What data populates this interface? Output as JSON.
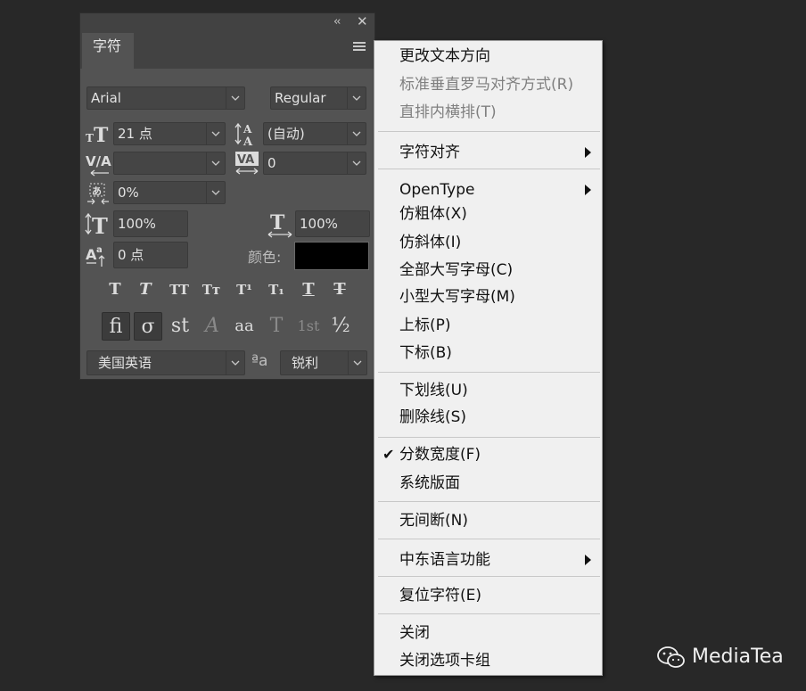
{
  "panel": {
    "tab_label": "字符",
    "collapse_glyph": "‹‹",
    "close_glyph": "✕",
    "font_family": "Arial",
    "font_style": "Regular",
    "font_size": "21 点",
    "leading": "(自动)",
    "kerning": "",
    "tracking": "0",
    "tsume": "0%",
    "vertical_scale": "100%",
    "horizontal_scale": "100%",
    "baseline_shift": "0 点",
    "color_label": "颜色:",
    "color_value": "#000000",
    "style_buttons": [
      {
        "name": "faux-bold",
        "glyph": "T"
      },
      {
        "name": "faux-italic",
        "glyph": "T"
      },
      {
        "name": "all-caps",
        "glyph": "TT"
      },
      {
        "name": "small-caps",
        "glyph": "Tт"
      },
      {
        "name": "superscript",
        "glyph": "T¹"
      },
      {
        "name": "subscript",
        "glyph": "T₁"
      },
      {
        "name": "underline",
        "glyph": "T"
      },
      {
        "name": "strikethrough",
        "glyph": "T"
      }
    ],
    "opentype_buttons": [
      {
        "name": "standard-ligatures",
        "glyph": "fi"
      },
      {
        "name": "contextual-alternates",
        "glyph": "σ"
      },
      {
        "name": "discretionary-ligatures",
        "glyph": "st"
      },
      {
        "name": "swash",
        "glyph": "A"
      },
      {
        "name": "stylistic-alternates",
        "glyph": "aa"
      },
      {
        "name": "titling-alternates",
        "glyph": "T"
      },
      {
        "name": "ordinals",
        "glyph": "1st"
      },
      {
        "name": "fractions",
        "glyph": "½"
      }
    ],
    "language": "美国英语",
    "aa_icon_glyph": "ªa",
    "antialias": "锐利"
  },
  "menu": {
    "items": [
      {
        "label": "更改文本方向",
        "disabled": false
      },
      {
        "label": "标准垂直罗马对齐方式(R)",
        "disabled": true
      },
      {
        "label": "直排内横排(T)",
        "disabled": true
      },
      {
        "label": "字符对齐",
        "submenu": true
      },
      {
        "label": "OpenType",
        "submenu": true
      },
      {
        "label": "仿粗体(X)"
      },
      {
        "label": "仿斜体(I)"
      },
      {
        "label": "全部大写字母(C)"
      },
      {
        "label": "小型大写字母(M)"
      },
      {
        "label": "上标(P)"
      },
      {
        "label": "下标(B)"
      },
      {
        "label": "下划线(U)"
      },
      {
        "label": "删除线(S)"
      },
      {
        "label": "分数宽度(F)",
        "checked": true
      },
      {
        "label": "系统版面"
      },
      {
        "label": "无间断(N)"
      },
      {
        "label": "中东语言功能",
        "submenu": true
      },
      {
        "label": "复位字符(E)"
      },
      {
        "label": "关闭"
      },
      {
        "label": "关闭选项卡组"
      }
    ],
    "check_glyph": "✔"
  },
  "watermark": {
    "text": "MediaTea"
  }
}
